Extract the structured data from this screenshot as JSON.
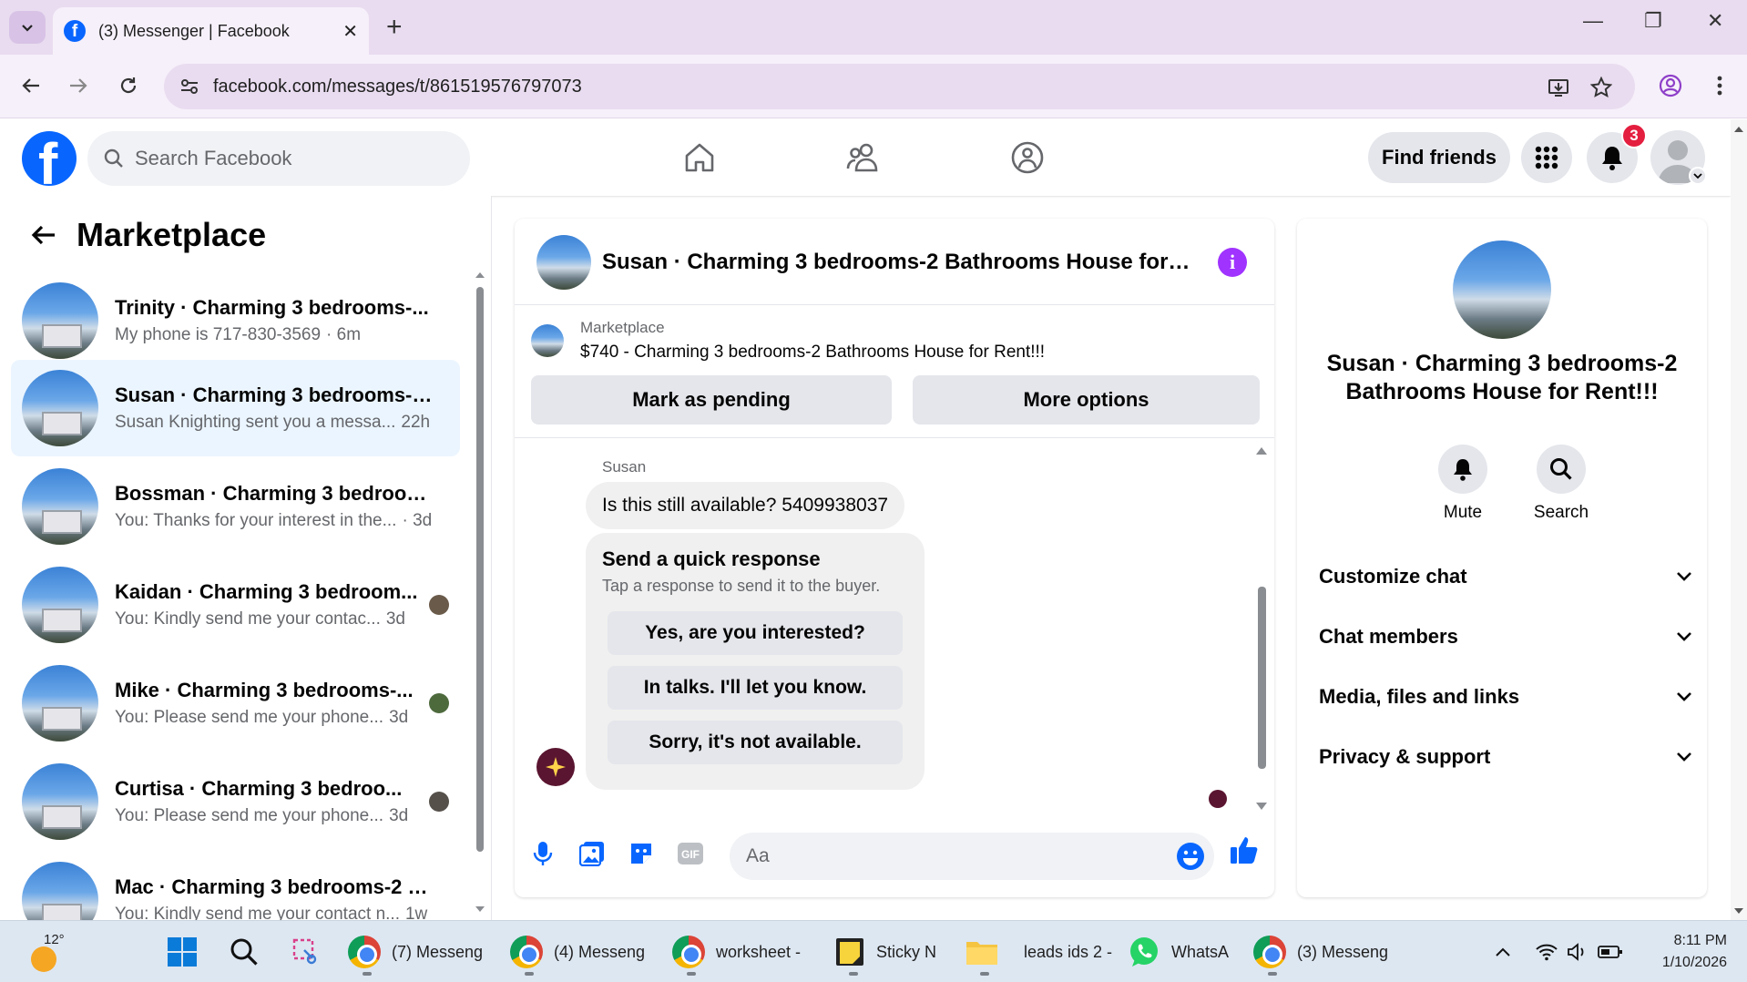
{
  "browser": {
    "tab_title": "(3) Messenger | Facebook",
    "url": "facebook.com/messages/t/861519576797073"
  },
  "fb": {
    "search_placeholder": "Search Facebook",
    "find_friends": "Find friends",
    "notification_count": "3"
  },
  "left": {
    "title": "Marketplace",
    "conversations": [
      {
        "name": "Trinity · Charming 3 bedrooms-...",
        "preview": "My phone is 717-830-3569",
        "time": "· 6m",
        "active": false
      },
      {
        "name": "Susan · Charming 3 bedrooms-2...",
        "preview": "Susan Knighting sent you a messa...",
        "time": "22h",
        "active": true
      },
      {
        "name": "Bossman · Charming 3 bedroom...",
        "preview": "You: Thanks for your interest in the...",
        "time": "· 3d",
        "active": false
      },
      {
        "name": "Kaidan · Charming 3 bedroom...",
        "preview": "You: Kindly send me your contac...",
        "time": "3d",
        "active": false
      },
      {
        "name": "Mike · Charming 3 bedrooms-...",
        "preview": "You: Please send me your phone...",
        "time": "3d",
        "active": false
      },
      {
        "name": "Curtisa · Charming 3 bedroo...",
        "preview": "You: Please send me your phone...",
        "time": "3d",
        "active": false
      },
      {
        "name": "Mac · Charming 3 bedrooms-2 B...",
        "preview": "You: Kindly send me your contact n...",
        "time": "1w",
        "active": false
      }
    ]
  },
  "chat": {
    "title": "Susan · Charming 3 bedrooms-2 Bathrooms House for Rent!!!",
    "marketplace_label": "Marketplace",
    "listing": "$740 - Charming 3 bedrooms-2 Bathrooms House for Rent!!!",
    "mark_pending": "Mark as pending",
    "more_options": "More options",
    "sender": "Susan",
    "message": "Is this still available? 5409938037",
    "quick_title": "Send a quick response",
    "quick_sub": "Tap a response to send it to the buyer.",
    "quick_replies": [
      "Yes, are you interested?",
      "In talks. I'll let you know.",
      "Sorry, it's not available."
    ],
    "composer_placeholder": "Aa"
  },
  "right": {
    "name": "Susan · Charming 3 bedrooms-2 Bathrooms House for Rent!!!",
    "mute": "Mute",
    "search": "Search",
    "sections": [
      "Customize chat",
      "Chat members",
      "Media, files and links",
      "Privacy & support"
    ]
  },
  "taskbar": {
    "temp": "12°",
    "apps": [
      {
        "label": "(7) Messeng"
      },
      {
        "label": "(4) Messeng"
      },
      {
        "label": "worksheet -"
      },
      {
        "label": "Sticky N"
      },
      {
        "label": "leads ids 2 -"
      },
      {
        "label": "WhatsA"
      },
      {
        "label": "(3) Messeng"
      }
    ],
    "time": "8:11 PM",
    "date": "1/10/2026"
  }
}
